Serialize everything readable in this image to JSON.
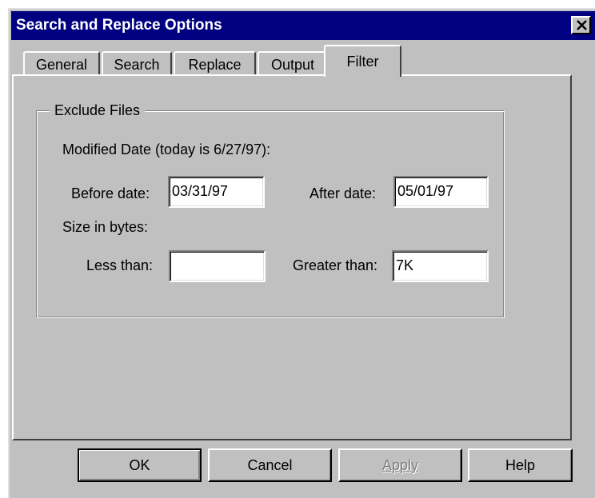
{
  "window": {
    "title": "Search and Replace Options",
    "close_glyph": "✕"
  },
  "tabs": [
    {
      "label": "General",
      "active": false
    },
    {
      "label": "Search",
      "active": false
    },
    {
      "label": "Replace",
      "active": false
    },
    {
      "label": "Output",
      "active": false
    },
    {
      "label": "Filter",
      "active": true
    }
  ],
  "filter": {
    "group_label": "Exclude Files",
    "modified_date_label": "Modified Date (today is 6/27/97):",
    "before_date": {
      "label": "Before date:",
      "value": "03/31/97"
    },
    "after_date": {
      "label": "After date:",
      "value": "05/01/97"
    },
    "size_label": "Size in bytes:",
    "less_than": {
      "label": "Less than:",
      "value": ""
    },
    "greater_than": {
      "label": "Greater than:",
      "value": "7K"
    }
  },
  "buttons": {
    "ok": "OK",
    "cancel": "Cancel",
    "apply": "Apply",
    "help": "Help"
  },
  "colors": {
    "titlebar": "#000080",
    "face": "#c0c0c0",
    "disabled_text": "#808080"
  },
  "icons": {
    "close": "close-icon"
  }
}
